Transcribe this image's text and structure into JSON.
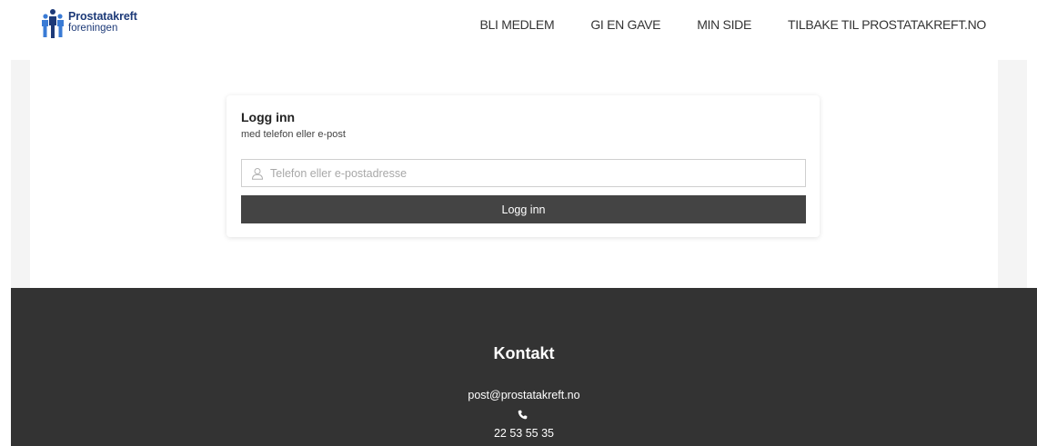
{
  "header": {
    "logo": {
      "line1": "Prostatakreft",
      "line2": "foreningen",
      "icon": "people-group-icon",
      "color": "#1d3a78"
    },
    "nav": [
      {
        "label": "BLI MEDLEM"
      },
      {
        "label": "GI EN GAVE"
      },
      {
        "label": "MIN SIDE"
      },
      {
        "label": "TILBAKE TIL PROSTATAKREFT.NO"
      }
    ]
  },
  "login": {
    "title": "Logg inn",
    "subtitle": "med telefon eller e-post",
    "input": {
      "placeholder": "Telefon eller e-postadresse",
      "value": "",
      "icon": "user-icon"
    },
    "submit_label": "Logg inn",
    "button_color": "#444444"
  },
  "footer": {
    "title": "Kontakt",
    "email": "post@prostatakreft.no",
    "phone_icon": "phone-icon",
    "phone": "22 53 55 35",
    "background": "#333333"
  }
}
